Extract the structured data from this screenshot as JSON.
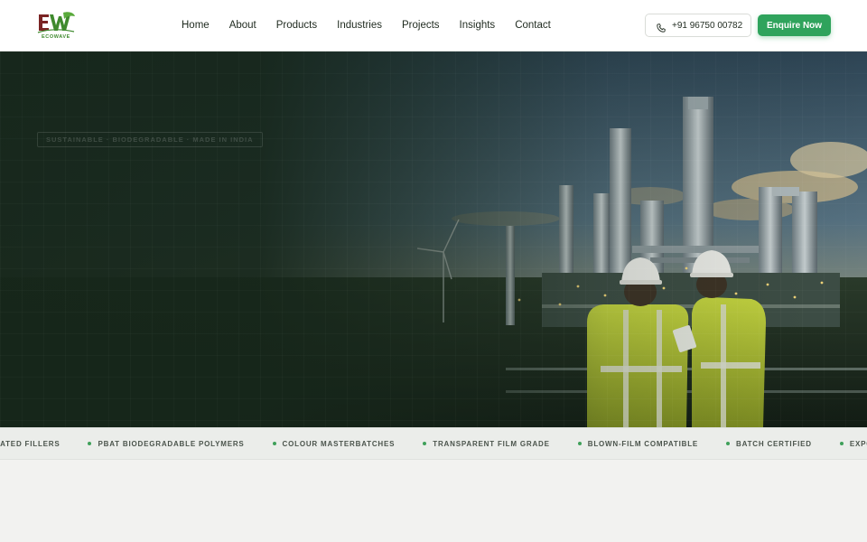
{
  "brand": {
    "logo_letters": "EW",
    "logo_word": "ECOWAVE"
  },
  "nav": {
    "items": [
      {
        "label": "Home"
      },
      {
        "label": "About"
      },
      {
        "label": "Products"
      },
      {
        "label": "Industries"
      },
      {
        "label": "Projects"
      },
      {
        "label": "Insights"
      },
      {
        "label": "Contact"
      }
    ]
  },
  "header": {
    "phone": "+91 96750 00782",
    "enquire_label": "Enquire Now",
    "accent": "#2fa35c"
  },
  "hero": {
    "badge": "SUSTAINABLE · BIODEGRADABLE · MADE IN INDIA"
  },
  "ticker": {
    "items": [
      "EATED FILLERS",
      "PBAT BIODEGRADABLE POLYMERS",
      "COLOUR MASTERBATCHES",
      "TRANSPARENT FILM GRADE",
      "BLOWN-FILM COMPATIBLE",
      "BATCH CERTIFIED",
      "EXPORT READY"
    ],
    "dot_color": "#3fa05a"
  }
}
